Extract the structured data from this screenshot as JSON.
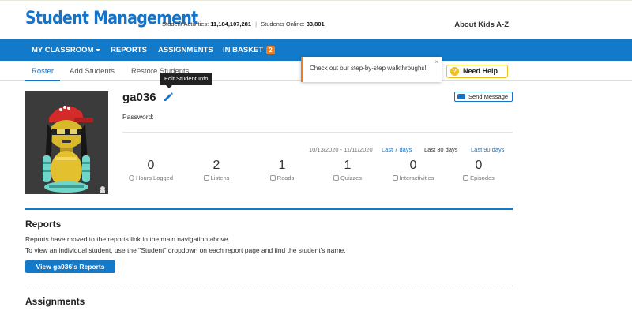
{
  "header": {
    "brand": "Student Management",
    "stats_activities_label": "Student Activities:",
    "stats_activities_value": "11,184,107,281",
    "stats_separator": "|",
    "stats_online_label": "Students Online:",
    "stats_online_value": "33,801",
    "about": "About Kids A-Z"
  },
  "nav": {
    "items": [
      {
        "label": "MY CLASSROOM"
      },
      {
        "label": "REPORTS"
      },
      {
        "label": "ASSIGNMENTS"
      },
      {
        "label": "IN BASKET"
      }
    ],
    "basket_count": "2"
  },
  "subtabs": {
    "items": [
      {
        "label": "Roster"
      },
      {
        "label": "Add Students"
      },
      {
        "label": "Restore Students"
      }
    ]
  },
  "tooltip": {
    "text": "Edit Student Info"
  },
  "popup": {
    "text": "Check out our step-by-step walkthroughs!",
    "close": "×"
  },
  "help": {
    "label": "Need Help",
    "icon_char": "?"
  },
  "student": {
    "username": "ga036",
    "password_label": "Password:",
    "send_message": "Send Message"
  },
  "date_range": {
    "range": "10/13/2020 - 11/11/2020",
    "options": [
      {
        "label": "Last 7 days"
      },
      {
        "label": "Last 30 days"
      },
      {
        "label": "Last 90 days"
      }
    ]
  },
  "stats": [
    {
      "value": "0",
      "label": "Hours Logged",
      "icon": "clock-icon"
    },
    {
      "value": "2",
      "label": "Listens",
      "icon": "headphones-icon"
    },
    {
      "value": "1",
      "label": "Reads",
      "icon": "book-icon"
    },
    {
      "value": "1",
      "label": "Quizzes",
      "icon": "question-icon"
    },
    {
      "value": "0",
      "label": "Interactivities",
      "icon": "interactivity-icon"
    },
    {
      "value": "0",
      "label": "Episodes",
      "icon": "episode-icon"
    }
  ],
  "reports": {
    "title": "Reports",
    "line1": "Reports have moved to the reports link in the main navigation above.",
    "line2": "To view an individual student, use the \"Student\" dropdown on each report page and find the student's name.",
    "button": "View ga036's Reports"
  },
  "assignments": {
    "title": "Assignments"
  },
  "colors": {
    "brand_blue": "#1379c9",
    "accent_orange": "#f07c22",
    "help_yellow": "#f0c020"
  }
}
